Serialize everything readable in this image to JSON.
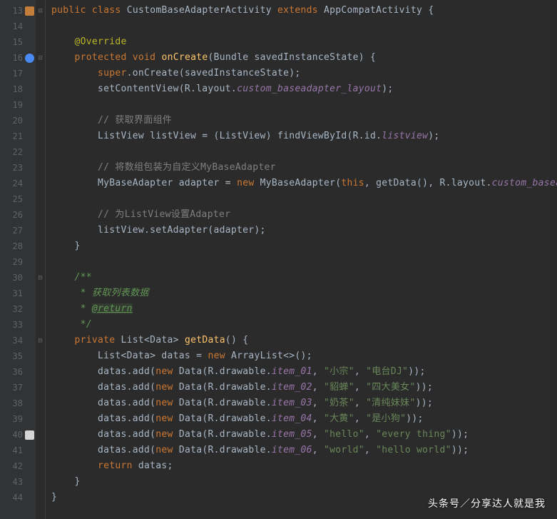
{
  "lines": {
    "start": 13,
    "end": 44
  },
  "gutter": {
    "l13_icon": "class-icon",
    "l16_icon": "override-icon",
    "l40_icon": "drawable-icon"
  },
  "fold": {
    "l13": "⊟",
    "l16": "⊟",
    "l30": "⊟",
    "l34": "⊟"
  },
  "code": {
    "l13_public": "public",
    "l13_class": "class",
    "l13_name": "CustomBaseAdapterActivity",
    "l13_extends": "extends",
    "l13_parent": "AppCompatActivity",
    "l13_brace": " {",
    "l15_anno": "@Override",
    "l16_protected": "protected",
    "l16_void": "void",
    "l16_method": "onCreate",
    "l16_sig": "(Bundle savedInstanceState) {",
    "l17_super": "super",
    "l17_rest": ".onCreate(savedInstanceState);",
    "l18_call": "setContentView(R.layout.",
    "l18_field": "custom_baseadapter_layout",
    "l18_end": ");",
    "l20_comment": "// 获取界面组件",
    "l21_a": "ListView listView = (ListView) findViewById(R.id.",
    "l21_field": "listview",
    "l21_end": ");",
    "l23_comment": "// 将数组包装为自定义MyBaseAdapter",
    "l24_a": "MyBaseAdapter adapter = ",
    "l24_new": "new",
    "l24_b": " MyBaseAdapter(",
    "l24_this": "this",
    "l24_c": ", getData(), R.layout.",
    "l24_field": "custom_baseadapter_item",
    "l24_end": ");",
    "l26_comment": "// 为ListView设置Adapter",
    "l27": "listView.setAdapter(adapter);",
    "l28": "}",
    "l30": "/**",
    "l31": " * 获取列表数据",
    "l32_a": " * ",
    "l32_tag": "@return",
    "l33": " */",
    "l34_private": "private",
    "l34_sig": " List<Data> ",
    "l34_method": "getData",
    "l34_end": "() {",
    "l35_a": "List<Data> datas = ",
    "l35_new": "new",
    "l35_b": " ArrayList<>();",
    "l36_a": "datas.add(",
    "l36_new": "new",
    "l36_b": " Data(R.drawable.",
    "l36_field": "item_01",
    "l36_c": ", ",
    "l36_s1": "\"小宗\"",
    "l36_d": ", ",
    "l36_s2": "\"电台DJ\"",
    "l36_end": "));",
    "l37_field": "item_02",
    "l37_s1": "\"貂蝉\"",
    "l37_s2": "\"四大美女\"",
    "l38_field": "item_03",
    "l38_s1": "\"奶茶\"",
    "l38_s2": "\"清纯妹妹\"",
    "l39_field": "item_04",
    "l39_s1": "\"大黄\"",
    "l39_s2": "\"是小狗\"",
    "l40_field": "item_05",
    "l40_s1": "\"hello\"",
    "l40_s2": "\"every thing\"",
    "l41_field": "item_06",
    "l41_s1": "\"world\"",
    "l41_s2": "\"hello world\"",
    "l42_return": "return",
    "l42_rest": " datas;",
    "l43": "}",
    "l44": "}"
  },
  "watermark": "头条号／分享达人就是我"
}
